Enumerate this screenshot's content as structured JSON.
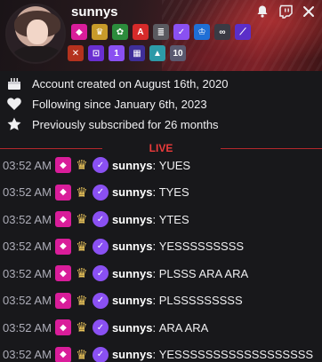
{
  "header": {
    "username": "sunnys",
    "icons": [
      "bell-icon",
      "twitch-icon",
      "close-icon"
    ],
    "badges_row1": [
      {
        "name": "gem-badge",
        "color": "#d91d9a",
        "glyph": "◆"
      },
      {
        "name": "crown-badge",
        "color": "#c89a2a",
        "glyph": "♛"
      },
      {
        "name": "palm-badge",
        "color": "#2c8c3c",
        "glyph": "✿"
      },
      {
        "name": "arc-badge",
        "color": "#d62a2a",
        "glyph": "A"
      },
      {
        "name": "stack-badge",
        "color": "#5a5a60",
        "glyph": "≣"
      },
      {
        "name": "verified-badge",
        "color": "#8a50f2",
        "glyph": "✓"
      },
      {
        "name": "prime-crown-badge",
        "color": "#1f6fd6",
        "glyph": "♔"
      },
      {
        "name": "glasses-badge",
        "color": "#3a3a44",
        "glyph": "∞"
      },
      {
        "name": "slash-badge",
        "color": "#5b2ec9",
        "glyph": "⟋"
      }
    ],
    "badges_row2": [
      {
        "name": "cross-badge",
        "color": "#b4321e",
        "glyph": "✕"
      },
      {
        "name": "ticket-badge",
        "color": "#6a2fd1",
        "glyph": "⊡"
      },
      {
        "name": "one-badge",
        "color": "#8a50f2",
        "glyph": "1"
      },
      {
        "name": "grid-badge",
        "color": "#3f2f9a",
        "glyph": "▦"
      },
      {
        "name": "sail-badge",
        "color": "#2d9aa8",
        "glyph": "▲"
      },
      {
        "name": "ten-badge",
        "color": "#5a5a70",
        "glyph": "10"
      }
    ]
  },
  "info": {
    "account_created": "Account created on August 16th, 2020",
    "following_since": "Following since January 6th, 2023",
    "subscribed": "Previously subscribed for 26 months"
  },
  "divider_label": "LIVE",
  "messages": [
    {
      "time": "03:52 AM",
      "user": "sunnys",
      "text": "YUES"
    },
    {
      "time": "03:52 AM",
      "user": "sunnys",
      "text": "TYES"
    },
    {
      "time": "03:52 AM",
      "user": "sunnys",
      "text": "YTES"
    },
    {
      "time": "03:52 AM",
      "user": "sunnys",
      "text": "YESSSSSSSSS"
    },
    {
      "time": "03:52 AM",
      "user": "sunnys",
      "text": "PLSSS ARA ARA"
    },
    {
      "time": "03:52 AM",
      "user": "sunnys",
      "text": "PLSSSSSSSSS"
    },
    {
      "time": "03:52 AM",
      "user": "sunnys",
      "text": "ARA ARA"
    },
    {
      "time": "03:52 AM",
      "user": "sunnys",
      "text": "YESSSSSSSSSSSSSSSSSS"
    }
  ],
  "colors": {
    "accent": "#8a50f2",
    "live": "#eb3b3b",
    "gem": "#d91d9a"
  }
}
